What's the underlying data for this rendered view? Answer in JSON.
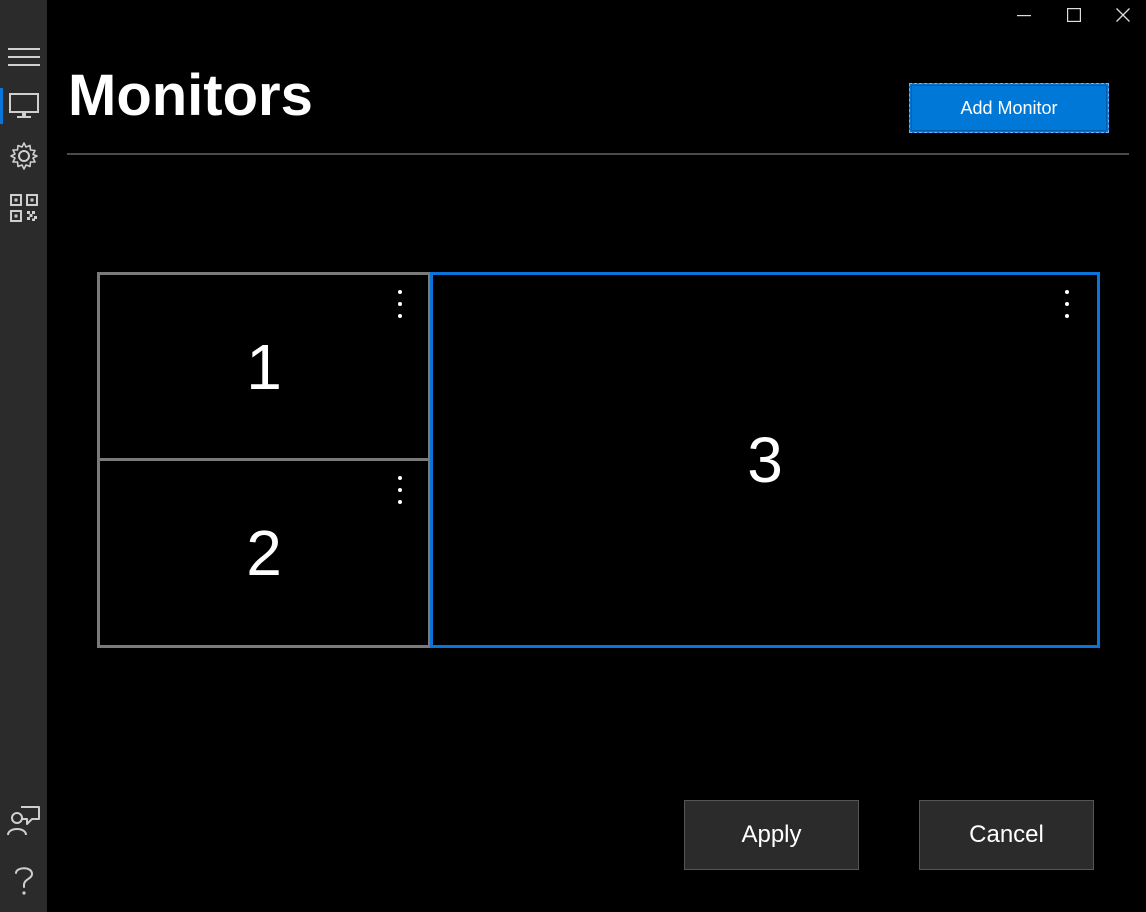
{
  "window": {
    "minimize_icon": "minimize-icon",
    "maximize_icon": "maximize-icon",
    "close_icon": "close-icon"
  },
  "sidebar": {
    "items": [
      {
        "icon": "hamburger-menu-icon"
      },
      {
        "icon": "monitor-icon",
        "active": true
      },
      {
        "icon": "gear-icon"
      },
      {
        "icon": "qr-code-icon"
      }
    ],
    "bottom_items": [
      {
        "icon": "feedback-icon"
      },
      {
        "icon": "help-icon"
      }
    ]
  },
  "header": {
    "title": "Monitors",
    "add_button_label": "Add Monitor"
  },
  "monitors": [
    {
      "number": "1",
      "selected": false
    },
    {
      "number": "2",
      "selected": false
    },
    {
      "number": "3",
      "selected": true
    }
  ],
  "footer": {
    "apply_label": "Apply",
    "cancel_label": "Cancel"
  },
  "colors": {
    "accent": "#0078d7",
    "selected_border": "#0a74d9",
    "unselected_border": "#7a7a7a",
    "sidebar_bg": "#2b2b2b",
    "background": "#000000"
  }
}
